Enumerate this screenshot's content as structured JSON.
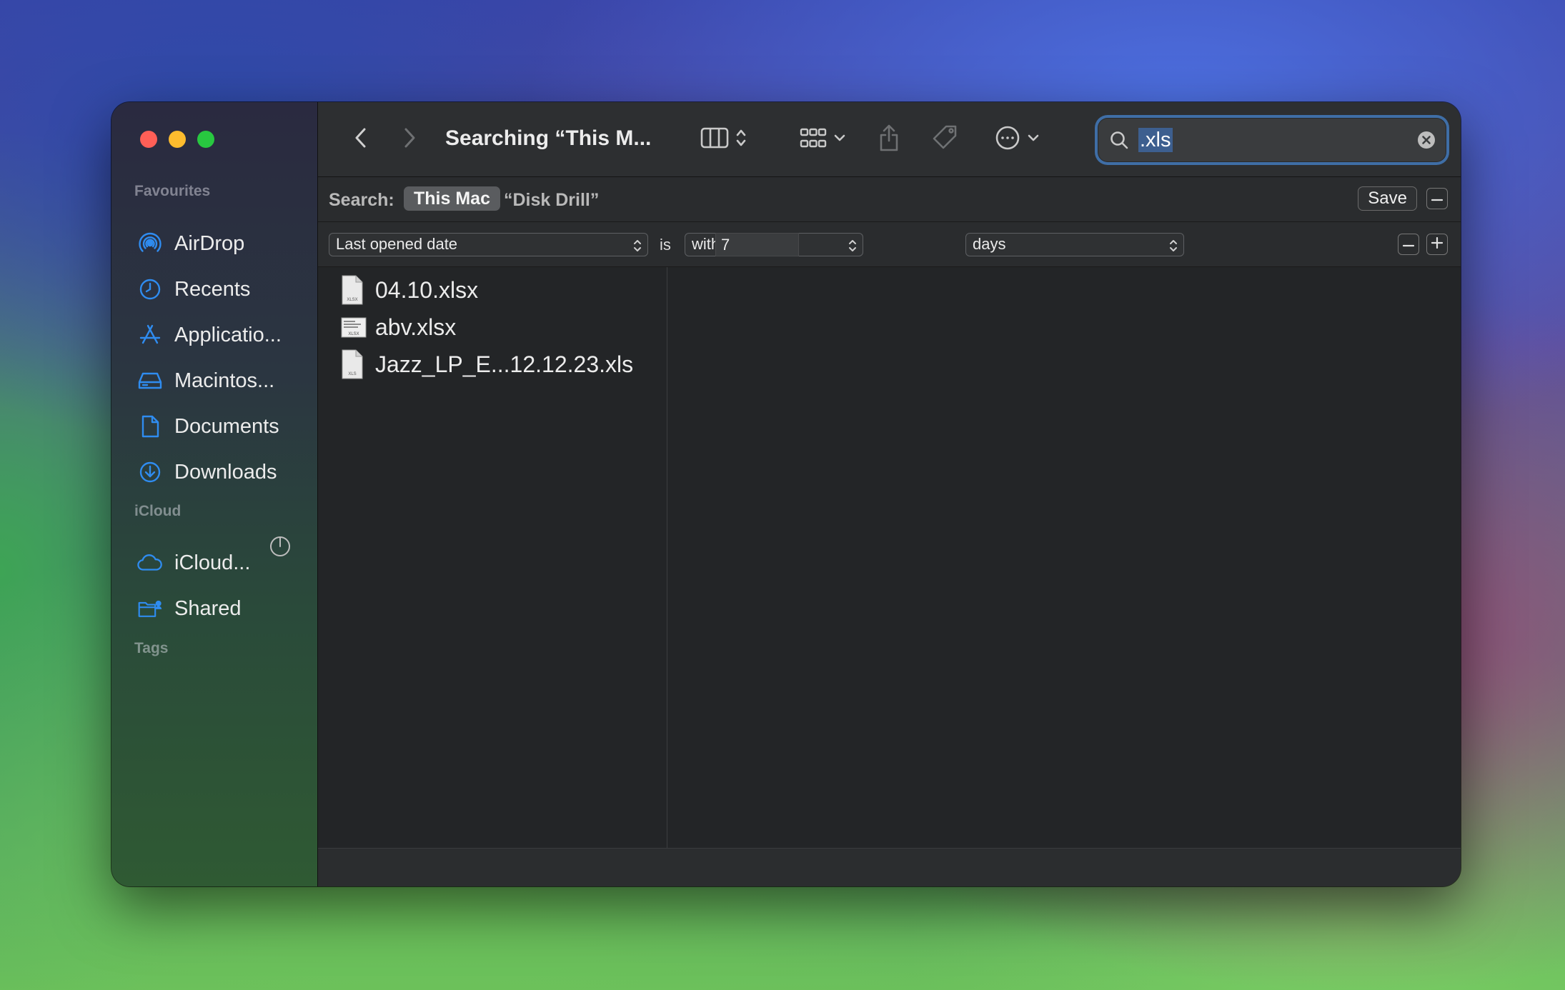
{
  "window": {
    "title": "Searching “This M..."
  },
  "sidebar": {
    "sections": {
      "favourites": "Favourites",
      "icloud": "iCloud",
      "tags": "Tags"
    },
    "favourites": [
      {
        "label": "AirDrop",
        "icon": "airdrop-icon"
      },
      {
        "label": "Recents",
        "icon": "clock-icon"
      },
      {
        "label": "Applicatio...",
        "icon": "applications-icon"
      },
      {
        "label": "Macintos...",
        "icon": "hard-drive-icon"
      },
      {
        "label": "Documents",
        "icon": "document-icon"
      },
      {
        "label": "Downloads",
        "icon": "download-icon"
      }
    ],
    "icloud": [
      {
        "label": "iCloud...",
        "icon": "cloud-icon"
      },
      {
        "label": "Shared",
        "icon": "shared-folder-icon"
      }
    ]
  },
  "toolbar": {
    "back_icon": "chevron-left-icon",
    "forward_icon": "chevron-right-icon",
    "view_icon": "columns-view-icon",
    "group_icon": "grid-icon",
    "share_icon": "share-icon",
    "tag_icon": "tag-icon",
    "more_icon": "ellipsis-circle-icon"
  },
  "search": {
    "query": ".xls",
    "scope_label": "Search:",
    "scope_this_mac": "This Mac",
    "scope_folder": "“Disk Drill”",
    "save_label": "Save"
  },
  "criteria": {
    "attribute": "Last opened date",
    "operator_label": "is",
    "operator": "within last",
    "value": "7",
    "unit": "days"
  },
  "results": [
    {
      "name": "04.10.xlsx",
      "ext": "XLSX"
    },
    {
      "name": "abv.xlsx",
      "ext": "XLSX"
    },
    {
      "name": "Jazz_LP_E...12.12.23.xls",
      "ext": "XLS"
    }
  ],
  "colors": {
    "accent": "#2f8cf0",
    "selection": "#3d5f8f",
    "close": "#ff5f57",
    "minimize": "#febc2e",
    "zoom": "#28c840"
  }
}
